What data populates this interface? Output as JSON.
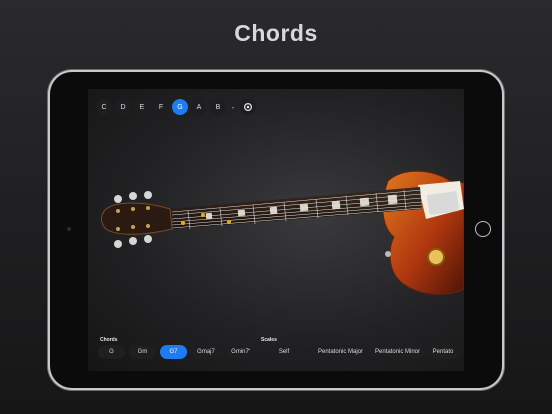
{
  "headline": "Chords",
  "keys": [
    {
      "label": "C",
      "active": false
    },
    {
      "label": "D",
      "active": false
    },
    {
      "label": "E",
      "active": false
    },
    {
      "label": "F",
      "active": false
    },
    {
      "label": "G",
      "active": true
    },
    {
      "label": "A",
      "active": false
    },
    {
      "label": "B",
      "active": false
    }
  ],
  "key_separator": "-",
  "chords": {
    "label": "Chords",
    "items": [
      {
        "label": "G",
        "active": false
      },
      {
        "label": "Gm",
        "active": false
      },
      {
        "label": "G7",
        "active": true
      },
      {
        "label": "Gmaj7",
        "active": false
      },
      {
        "label": "Gmin7",
        "active": false
      }
    ]
  },
  "bar_separator": "-",
  "scales": {
    "label": "Scales",
    "items": [
      {
        "label": "Self",
        "active": false
      },
      {
        "label": "Pentatonic Major",
        "active": false
      },
      {
        "label": "Pentatonic Minor",
        "active": false
      },
      {
        "label": "Pentato",
        "active": false
      }
    ]
  },
  "colors": {
    "accent": "#1e7cf2",
    "fret_dot": "#f2a71b"
  }
}
